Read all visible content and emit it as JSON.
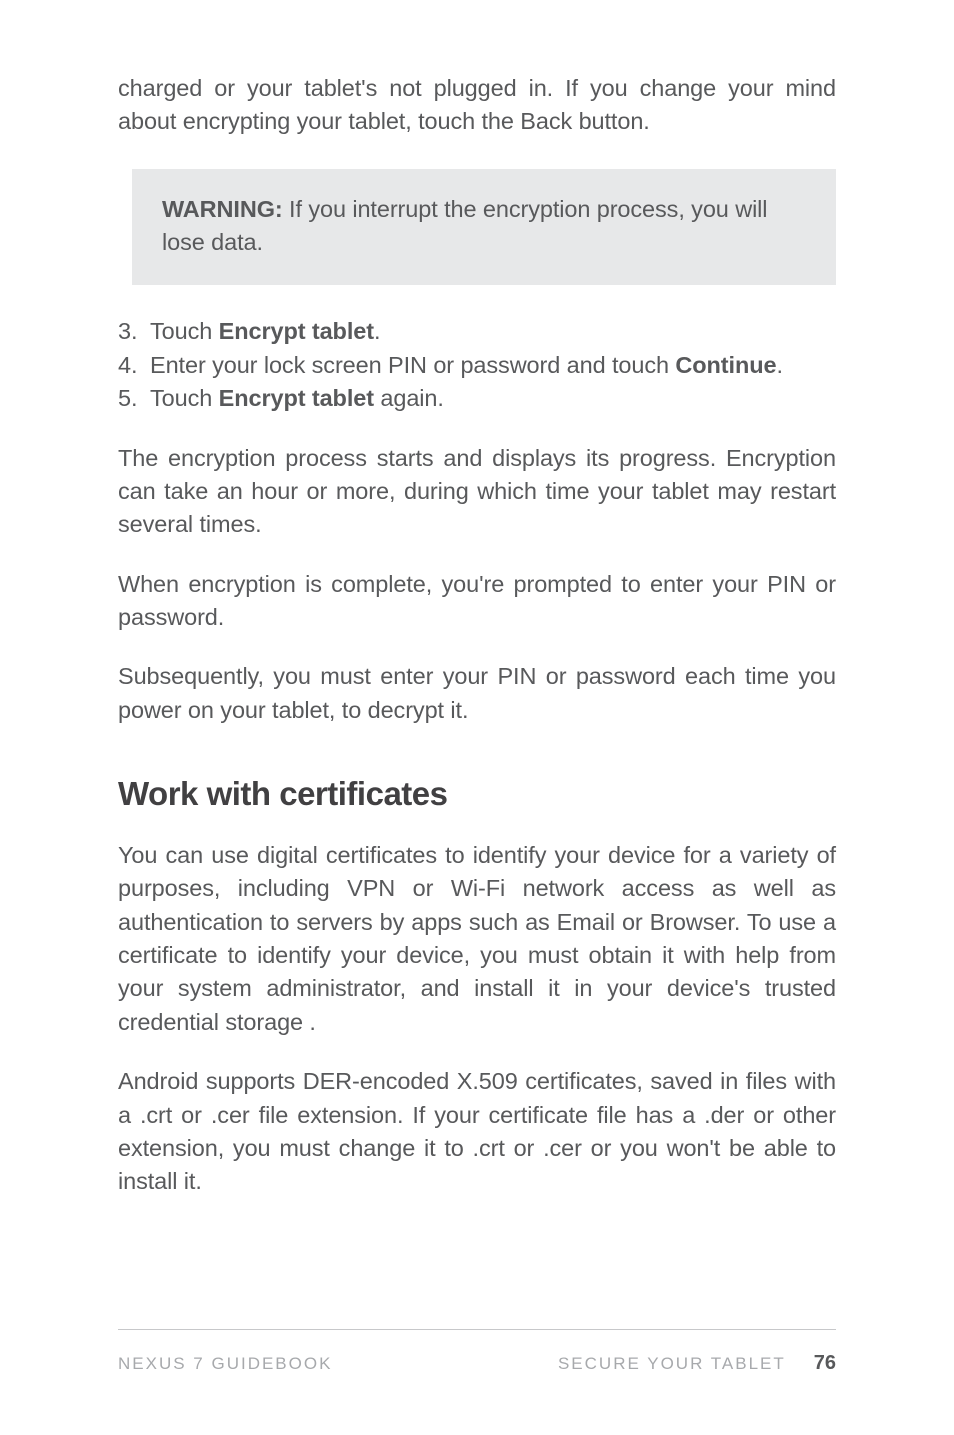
{
  "intro_paragraph": "charged or your tablet's not plugged in. If you change your mind about encrypting your tablet, touch the Back button.",
  "warning": {
    "label": "WARNING:",
    "text": " If you interrupt the encryption process, you will lose data."
  },
  "steps": [
    {
      "num": "3.",
      "prefix": "Touch ",
      "bold": "Encrypt tablet",
      "suffix": "."
    },
    {
      "num": "4.",
      "prefix": "Enter your lock screen PIN or password and touch ",
      "bold": "Continue",
      "suffix": "."
    },
    {
      "num": "5.",
      "prefix": "Touch ",
      "bold": "Encrypt tablet",
      "suffix": " again."
    }
  ],
  "para_progress": "The encryption process starts and displays its progress. Encryp­tion can take an hour or more, during which time your tablet may restart several times.",
  "para_complete": "When encryption is complete, you're prompted to enter your PIN or password.",
  "para_subsequent": "Subsequently, you must enter your PIN or password each time you power on your tablet, to decrypt it.",
  "heading_certificates": "Work with certificates",
  "para_cert_intro": "You can use digital certificates to identify your device for a variety of purposes, including VPN or Wi-Fi network access as well as authentication to servers by apps such as Email or Browser. To use a certificate to identify your device, you must obtain it with help from your system administrator, and install it in your device's trusted credential storage .",
  "para_cert_support": "Android supports DER-encoded X.509 certificates, saved in files with a .crt or .cer file extension. If your certificate file has a .der or other extension, you must change it to .crt or .cer or you won't be able to install it.",
  "footer": {
    "left": "NEXUS 7 GUIDEBOOK",
    "section": "SECURE YOUR TABLET",
    "page": "76"
  }
}
